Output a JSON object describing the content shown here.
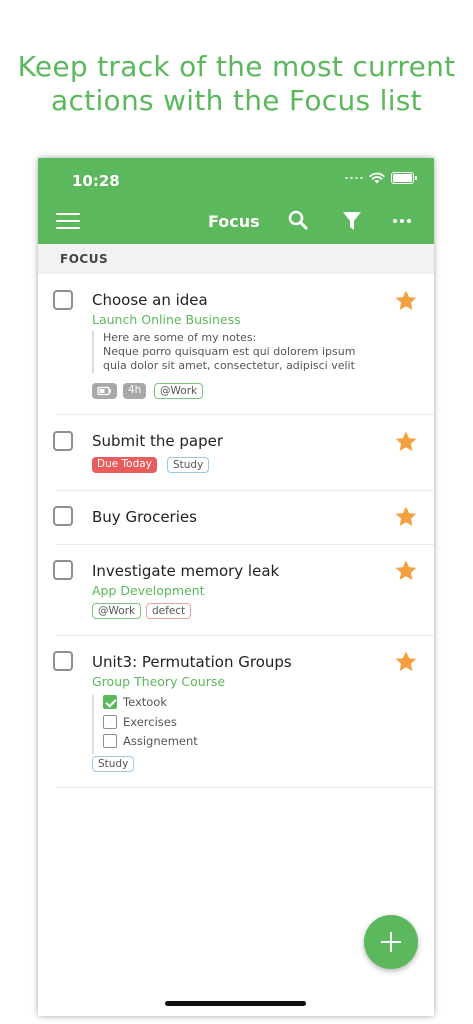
{
  "headline": {
    "line1": "Keep track of the most current",
    "line2": "actions with the Focus list"
  },
  "status_bar": {
    "time": "10:28"
  },
  "app_bar": {
    "title": "Focus",
    "icons": [
      "menu-icon",
      "search-icon",
      "filter-icon",
      "more-icon"
    ]
  },
  "section": {
    "title": "FOCUS"
  },
  "tasks": [
    {
      "title": "Choose an idea",
      "project": "Launch Online Business",
      "starred": true,
      "note": [
        "Here are some of my notes:",
        "Neque porro quisquam est qui dolorem ipsum",
        "quia dolor sit amet, consectetur, adipisci velit"
      ],
      "tags": [
        "4h",
        "@Work"
      ],
      "icons": [
        "battery-tag-icon"
      ]
    },
    {
      "title": "Submit the paper",
      "starred": true,
      "tags": [
        "Due Today",
        "Study"
      ]
    },
    {
      "title": "Buy Groceries",
      "starred": true
    },
    {
      "title": "Investigate memory leak",
      "project": "App Development",
      "starred": true,
      "tags": [
        "@Work",
        "defect"
      ]
    },
    {
      "title": "Unit3: Permutation Groups",
      "project": "Group Theory Course",
      "starred": true,
      "checklist": [
        {
          "label": "Textook",
          "checked": true
        },
        {
          "label": "Exercises",
          "checked": false
        },
        {
          "label": "Assignement",
          "checked": false
        }
      ],
      "tags": [
        "Study"
      ]
    }
  ],
  "colors": {
    "accent": "#5cb85c",
    "star": "#f5a040",
    "due": "#e85c5c"
  },
  "fab": {
    "icon": "plus-icon"
  }
}
